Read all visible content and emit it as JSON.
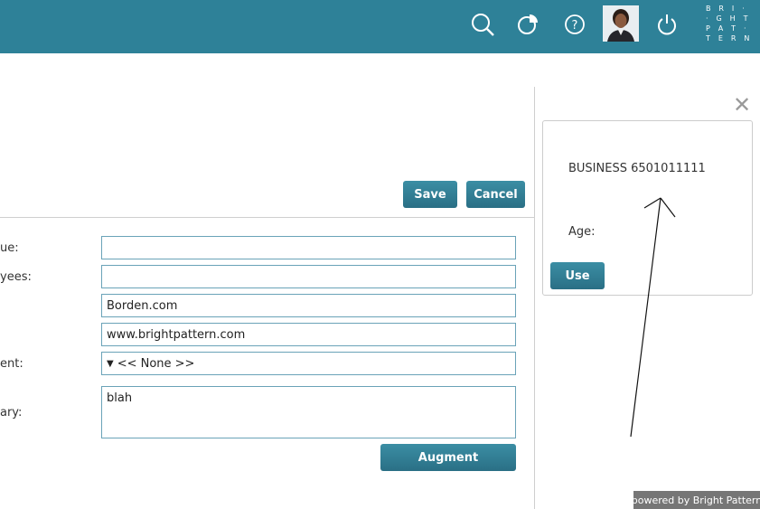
{
  "topbar": {
    "background": "#2e8198",
    "icons": [
      "search-icon",
      "chart-icon",
      "help-icon",
      "avatar",
      "power-icon"
    ],
    "logo_rows": [
      "B R I ·",
      "· G H T",
      "P A T ·",
      "T E R N"
    ]
  },
  "form": {
    "save_label": "Save",
    "cancel_label": "Cancel",
    "augment_label": "Augment",
    "labels": [
      "ue:",
      "yees:",
      "ent:",
      "ary:"
    ],
    "fields": {
      "revenue": "",
      "employees": "",
      "domain": "Borden.com",
      "website": "www.brightpattern.com",
      "segment_selected": "<< None >>",
      "summary": "blah"
    }
  },
  "side_panel": {
    "close_glyph": "✕",
    "phone_text": "BUSINESS 6501011111",
    "age_label": "Age:",
    "use_label": "Use"
  },
  "footer": {
    "powered_by": "powered by Bright Pattern"
  },
  "colors": {
    "accent": "#2e8198",
    "button": "#2f7d93",
    "field_border": "#6aa3b8"
  }
}
